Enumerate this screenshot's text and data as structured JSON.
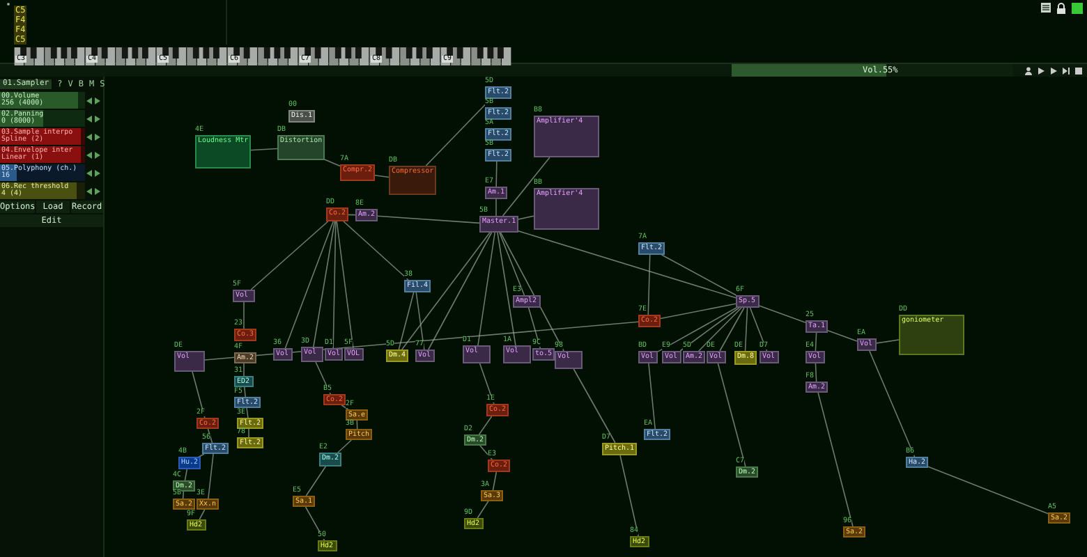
{
  "pattern": {
    "notes": [
      "C5",
      "F4",
      "F4",
      "C5"
    ]
  },
  "keyboard": {
    "octaves": [
      "C3",
      "C4",
      "C5",
      "C6",
      "C7",
      "C8",
      "C9"
    ]
  },
  "volume": {
    "label": "Vol.55%",
    "level": 0.55
  },
  "module_panel": {
    "title": "01.Sampler",
    "flags": [
      "?",
      "V",
      "B",
      "M",
      "S"
    ],
    "controllers": [
      {
        "name": "00.Volume",
        "value": "256 (4000)",
        "kind": "normal",
        "level": 0.92
      },
      {
        "name": "02.Panning",
        "value": "0 (8000)",
        "kind": "normal",
        "level": 0.5
      },
      {
        "name": "03.Sample interpo",
        "value": "Spline (2)",
        "kind": "selector",
        "level": 0.95
      },
      {
        "name": "04.Envelope inter",
        "value": "Linear (1)",
        "kind": "selector",
        "level": 0.95
      },
      {
        "name": "05.Polyphony (ch.)",
        "value": "16",
        "kind": "count",
        "level": 0.2
      },
      {
        "name": "06.Rec threshold",
        "value": "4 (4)",
        "kind": "threshold",
        "level": 0.9
      }
    ],
    "buttons": [
      "Options",
      "Load",
      "Record",
      "Edit"
    ]
  },
  "modules": [
    {
      "number": "5D",
      "name": "Flt.2",
      "kind": "filter"
    },
    {
      "number": "00",
      "name": "Dis.1",
      "kind": "gray"
    },
    {
      "number": "5B",
      "name": "Flt.2",
      "kind": "filter"
    },
    {
      "number": "B8",
      "name": "Amplifier'4",
      "kind": "amp"
    },
    {
      "number": "5A",
      "name": "Flt.2",
      "kind": "filter"
    },
    {
      "number": "4E",
      "name": "Loudness Mtr",
      "kind": "meter"
    },
    {
      "number": "DB",
      "name": "Distortion",
      "kind": "distortion"
    },
    {
      "number": "5B",
      "name": "Flt.2",
      "kind": "filter"
    },
    {
      "number": "7A",
      "name": "Compr.2",
      "kind": "red"
    },
    {
      "number": "DB",
      "name": "Compressor",
      "kind": "brown"
    },
    {
      "number": "E7",
      "name": "Am.1",
      "kind": "amp"
    },
    {
      "number": "BB",
      "name": "Amplifier'4",
      "kind": "amp"
    },
    {
      "number": "DD",
      "name": "Co.2",
      "kind": "red"
    },
    {
      "number": "8E",
      "name": "Am.2",
      "kind": "amp"
    },
    {
      "number": "5B",
      "name": "Master.1",
      "kind": "amp"
    },
    {
      "number": "7A",
      "name": "Flt.2",
      "kind": "filter"
    },
    {
      "number": "5F",
      "name": "Vol",
      "kind": "amp"
    },
    {
      "number": "38",
      "name": "Fil.4",
      "kind": "filter"
    },
    {
      "number": "E3",
      "name": "Ampl2",
      "kind": "amp"
    },
    {
      "number": "6F",
      "name": "Sp.5",
      "kind": "amp"
    },
    {
      "number": "7E",
      "name": "Co.2",
      "kind": "red"
    },
    {
      "number": "25",
      "name": "Ta.1",
      "kind": "amp"
    },
    {
      "number": "DD",
      "name": "goniometer",
      "kind": "gonio"
    },
    {
      "number": "23",
      "name": "Co.3",
      "kind": "red"
    },
    {
      "number": "EA",
      "name": "Vol",
      "kind": "amp"
    },
    {
      "number": "DE",
      "name": "Vol",
      "kind": "amp"
    },
    {
      "number": "4F",
      "name": "Am.2",
      "kind": "tan"
    },
    {
      "number": "36",
      "name": "Vol",
      "kind": "amp"
    },
    {
      "number": "3D",
      "name": "Vol",
      "kind": "amp"
    },
    {
      "number": "D1",
      "name": "Vol",
      "kind": "amp"
    },
    {
      "number": "5F",
      "name": "VOL",
      "kind": "amp"
    },
    {
      "number": "5D",
      "name": "Dm.4",
      "kind": "yellow"
    },
    {
      "number": "77",
      "name": "Vol",
      "kind": "amp"
    },
    {
      "number": "D1",
      "name": "Vol",
      "kind": "amp"
    },
    {
      "number": "1A",
      "name": "Vol",
      "kind": "amp"
    },
    {
      "number": "9C",
      "name": "to.5",
      "kind": "amp"
    },
    {
      "number": "98",
      "name": "Vol",
      "kind": "amp"
    },
    {
      "number": "BD",
      "name": "Vol",
      "kind": "amp"
    },
    {
      "number": "E9",
      "name": "Vol",
      "kind": "amp"
    },
    {
      "number": "5D",
      "name": "Am.2",
      "kind": "amp"
    },
    {
      "number": "DE",
      "name": "Vol",
      "kind": "amp"
    },
    {
      "number": "DE",
      "name": "Dm.8",
      "kind": "yellow"
    },
    {
      "number": "D7",
      "name": "Vol",
      "kind": "amp"
    },
    {
      "number": "E4",
      "name": "Vol",
      "kind": "amp"
    },
    {
      "number": "31",
      "name": "ED2",
      "kind": "teal"
    },
    {
      "number": "F8",
      "name": "Am.2",
      "kind": "amp"
    },
    {
      "number": "F5",
      "name": "Flt.2",
      "kind": "filter"
    },
    {
      "number": "B5",
      "name": "Co.2",
      "kind": "red"
    },
    {
      "number": "1E",
      "name": "Co.2",
      "kind": "red"
    },
    {
      "number": "2F",
      "name": "Co.2",
      "kind": "red"
    },
    {
      "number": "3E",
      "name": "Flt.2",
      "kind": "yellow"
    },
    {
      "number": "2F",
      "name": "Sa.e",
      "kind": "orange"
    },
    {
      "number": "3B",
      "name": "Pitch",
      "kind": "orange"
    },
    {
      "number": "EA",
      "name": "Flt.2",
      "kind": "filter"
    },
    {
      "number": "56",
      "name": "Flt.2",
      "kind": "filter"
    },
    {
      "number": "78",
      "name": "Flt.2",
      "kind": "yellow"
    },
    {
      "number": "D2",
      "name": "Dm.2",
      "kind": "green"
    },
    {
      "number": "D7",
      "name": "Pitch.1",
      "kind": "yellow"
    },
    {
      "number": "4B",
      "name": "Hu.2",
      "kind": "darkblue"
    },
    {
      "number": "E2",
      "name": "Dm.2",
      "kind": "teal"
    },
    {
      "number": "E3",
      "name": "Co.2",
      "kind": "red"
    },
    {
      "number": "C7",
      "name": "Dm.2",
      "kind": "green"
    },
    {
      "number": "B6",
      "name": "Ha.2",
      "kind": "filter"
    },
    {
      "number": "4C",
      "name": "Dm.2",
      "kind": "green"
    },
    {
      "number": "3A",
      "name": "Sa.3",
      "kind": "orange"
    },
    {
      "number": "5B",
      "name": "Sa.2",
      "kind": "orange"
    },
    {
      "number": "3E",
      "name": "Xx.n",
      "kind": "orange"
    },
    {
      "number": "E5",
      "name": "Sa.1",
      "kind": "orange"
    },
    {
      "number": "9F",
      "name": "Hd2",
      "kind": "lime"
    },
    {
      "number": "9D",
      "name": "Hd2",
      "kind": "lime"
    },
    {
      "number": "96",
      "name": "Sa.2",
      "kind": "orange"
    },
    {
      "number": "A5",
      "name": "Sa.2",
      "kind": "orange"
    },
    {
      "number": "50",
      "name": "Hd2",
      "kind": "lime"
    },
    {
      "number": "84",
      "name": "Hd2",
      "kind": "lime"
    }
  ]
}
